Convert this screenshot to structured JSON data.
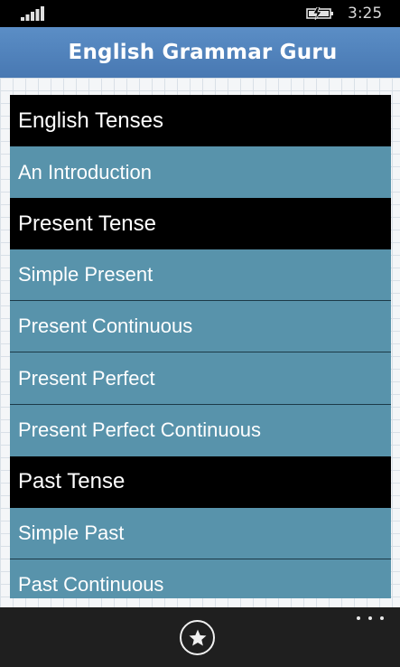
{
  "status_bar": {
    "signal_icon": "signal-strength-icon",
    "battery_icon": "battery-charging-icon",
    "time": "3:25"
  },
  "header": {
    "title": "English Grammar Guru",
    "background_color": "#4f81bd"
  },
  "topics": [
    {
      "label": "English Tenses",
      "kind": "section"
    },
    {
      "label": "An Introduction",
      "kind": "item"
    },
    {
      "label": "Present Tense",
      "kind": "section"
    },
    {
      "label": "Simple Present",
      "kind": "item"
    },
    {
      "label": "Present Continuous",
      "kind": "item"
    },
    {
      "label": "Present Perfect",
      "kind": "item"
    },
    {
      "label": "Present Perfect Continuous",
      "kind": "item"
    },
    {
      "label": "Past Tense",
      "kind": "section"
    },
    {
      "label": "Simple Past",
      "kind": "item"
    },
    {
      "label": "Past Continuous",
      "kind": "item"
    }
  ],
  "colors": {
    "section_background": "#000000",
    "item_background": "#5893ab",
    "item_text": "#ffffff"
  },
  "app_bar": {
    "favorite_icon": "star-icon",
    "more_icon": "ellipsis-icon"
  }
}
